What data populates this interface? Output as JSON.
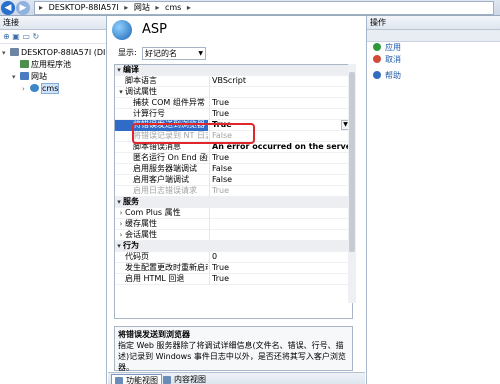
{
  "address": {
    "crumbs": [
      "DESKTOP-88IA57I",
      "网站",
      "cms"
    ]
  },
  "connections": {
    "title": "连接",
    "tree": {
      "server": "DESKTOP-88IA57I (DI",
      "pools": "应用程序池",
      "sites": "网站",
      "site": "cms"
    }
  },
  "main": {
    "title": "ASP",
    "display_label": "显示:",
    "display_value": "好记的名"
  },
  "properties": [
    {
      "kind": "cat",
      "name": "编译",
      "value": "",
      "exp": "▾"
    },
    {
      "kind": "row",
      "name": "脚本语言",
      "value": "VBScript",
      "indent": 1
    },
    {
      "kind": "cat2",
      "name": "调试属性",
      "value": "",
      "exp": "▾",
      "indent": 1
    },
    {
      "kind": "row",
      "name": "捕获 COM 组件异常",
      "value": "True",
      "indent": 2
    },
    {
      "kind": "row",
      "name": "计算行号",
      "value": "True",
      "indent": 2
    },
    {
      "kind": "selected",
      "name": "将错误发送到浏览器",
      "value": "True",
      "indent": 2
    },
    {
      "kind": "faded",
      "name": "将错误记录到 NT 日志",
      "value": "False",
      "indent": 2
    },
    {
      "kind": "bold",
      "name": "脚本错误消息",
      "value": "An error occurred on the server",
      "indent": 2
    },
    {
      "kind": "row",
      "name": "匿名运行 On End 函数",
      "value": "True",
      "indent": 2
    },
    {
      "kind": "row",
      "name": "启用服务器端调试",
      "value": "False",
      "indent": 2
    },
    {
      "kind": "row",
      "name": "启用客户端调试",
      "value": "False",
      "indent": 2
    },
    {
      "kind": "faded",
      "name": "启用日志错误请求",
      "value": "True",
      "indent": 2
    },
    {
      "kind": "cat",
      "name": "服务",
      "value": "",
      "exp": "▾"
    },
    {
      "kind": "row",
      "name": "Com Plus 属性",
      "value": "",
      "exp": "›",
      "indent": 1
    },
    {
      "kind": "row",
      "name": "缓存属性",
      "value": "",
      "exp": "›",
      "indent": 1
    },
    {
      "kind": "row",
      "name": "会话属性",
      "value": "",
      "exp": "›",
      "indent": 1
    },
    {
      "kind": "cat",
      "name": "行为",
      "value": "",
      "exp": "▾"
    },
    {
      "kind": "row",
      "name": "代码页",
      "value": "0",
      "indent": 1
    },
    {
      "kind": "row",
      "name": "发生配置更改时重新启动",
      "value": "True",
      "indent": 1
    },
    {
      "kind": "row",
      "name": "启用 HTML 回退",
      "value": "True",
      "indent": 1
    }
  ],
  "description": {
    "title": "将错误发送到浏览器",
    "text": "指定 Web 服务器除了将调试详细信息(文件名、错误、行号、描述)记录到 Windows 事件日志中以外，是否还将其写入客户浏览器。"
  },
  "view_tabs": {
    "features": "功能视图",
    "content": "内容视图"
  },
  "actions": {
    "title": "操作",
    "apply": "应用",
    "cancel": "取消",
    "help": "帮助"
  }
}
